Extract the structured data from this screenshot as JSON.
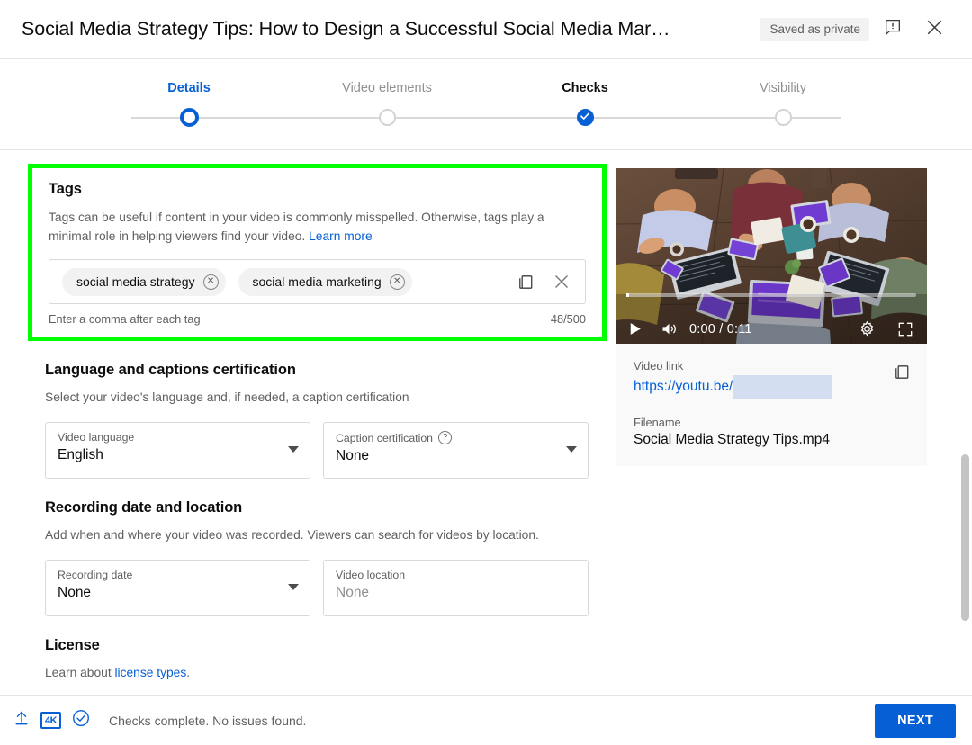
{
  "colors": {
    "accent_blue": "#065fd4",
    "highlight_green": "#00ff00",
    "chip_gray": "#f2f2f2",
    "panel_gray": "#f9f9f9"
  },
  "header": {
    "title": "Social Media Strategy Tips: How to Design a Successful Social Media Mar…",
    "saved_status": "Saved as private",
    "feedback_icon": "feedback-bubble-icon",
    "close_icon": "close-icon"
  },
  "stepper": {
    "steps": [
      {
        "label": "Details",
        "state": "current"
      },
      {
        "label": "Video elements",
        "state": "todo"
      },
      {
        "label": "Checks",
        "state": "complete"
      },
      {
        "label": "Visibility",
        "state": "todo"
      }
    ]
  },
  "tags": {
    "title": "Tags",
    "description_part1": "Tags can be useful if content in your video is commonly misspelled. Otherwise, tags play a minimal role in helping viewers find your video. ",
    "learn_more": "Learn more",
    "chips": [
      {
        "label": "social media strategy"
      },
      {
        "label": "social media marketing"
      }
    ],
    "copy_icon": "copy-icon",
    "clear_icon": "clear-all-icon",
    "hint": "Enter a comma after each tag",
    "counter": "48/500"
  },
  "language_section": {
    "title": "Language and captions certification",
    "description": "Select your video's language and, if needed, a caption certification",
    "video_language": {
      "label": "Video language",
      "value": "English"
    },
    "caption_certification": {
      "label": "Caption certification",
      "value": "None",
      "help_icon": "help-icon"
    }
  },
  "recording_section": {
    "title": "Recording date and location",
    "description": "Add when and where your video was recorded. Viewers can search for videos by location.",
    "recording_date": {
      "label": "Recording date",
      "value": "None"
    },
    "video_location": {
      "label": "Video location",
      "value": "None",
      "is_placeholder": true
    }
  },
  "license_section": {
    "title": "License",
    "text_prefix": "Learn about ",
    "link_text": "license types",
    "text_suffix": "."
  },
  "preview": {
    "player": {
      "play_icon": "play-icon",
      "volume_icon": "volume-icon",
      "time": "0:00 / 0:11",
      "settings_icon": "gear-icon",
      "fullscreen_icon": "fullscreen-icon"
    },
    "video_link_label": "Video link",
    "video_link_value": "https://youtu.be/",
    "copy_link_icon": "copy-icon",
    "filename_label": "Filename",
    "filename_value": "Social Media Strategy Tips.mp4"
  },
  "footer": {
    "upload_icon": "upload-icon",
    "resolution_badge": "4K",
    "checks_icon": "check-circle-icon",
    "status": "Checks complete. No issues found.",
    "next_label": "NEXT"
  }
}
